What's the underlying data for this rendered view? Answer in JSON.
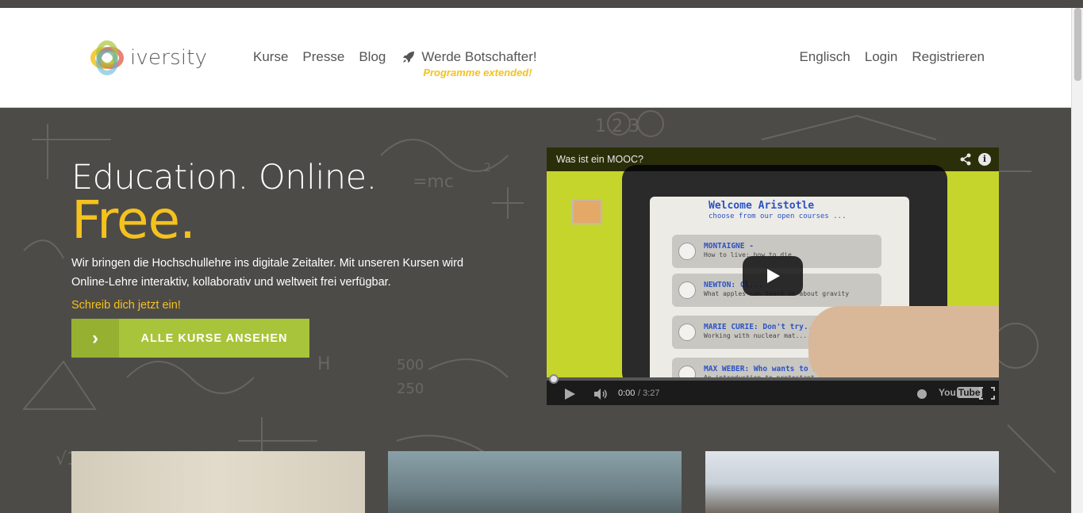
{
  "header": {
    "logo_text": "iversity",
    "nav": [
      "Kurse",
      "Presse",
      "Blog"
    ],
    "promo": {
      "label": "Werde Botschafter!",
      "sub": "Programme extended!",
      "icon": "rocket-icon"
    },
    "right_nav": [
      "Englisch",
      "Login",
      "Registrieren"
    ]
  },
  "hero": {
    "title": "Education. Online.",
    "title_accent": "Free.",
    "description": "Wir bringen die Hochschullehre ins digitale Zeitalter. Mit unseren Kursen wird Online-Lehre interaktiv, kollaborativ und weltweit frei verfügbar.",
    "cta_text": "Schreib dich jetzt ein!",
    "button_label": "ALLE KURSE ANSEHEN",
    "accent_color": "#f4c21d",
    "button_color": "#a8c43a"
  },
  "video": {
    "title": "Was ist ein MOOC?",
    "time_current": "0:00",
    "time_total": "/ 3:27",
    "progress": 0,
    "screen": {
      "welcome": "Welcome Aristotle",
      "welcome_sub": "choose from our open courses ...",
      "courses": [
        {
          "title": "MONTAIGNE -",
          "sub": "How to live: how to die"
        },
        {
          "title": "NEWTON: Cl...",
          "sub": "What apples can teach us about gravity"
        },
        {
          "title": "MARIE CURIE: Don't try...",
          "sub": "Working with nuclear mat..."
        },
        {
          "title": "MAX WEBER: Who wants to be a...",
          "sub": "An introduction to protestant ethic"
        }
      ]
    },
    "youtube_label": "You",
    "youtube_label_tube": "Tube"
  }
}
